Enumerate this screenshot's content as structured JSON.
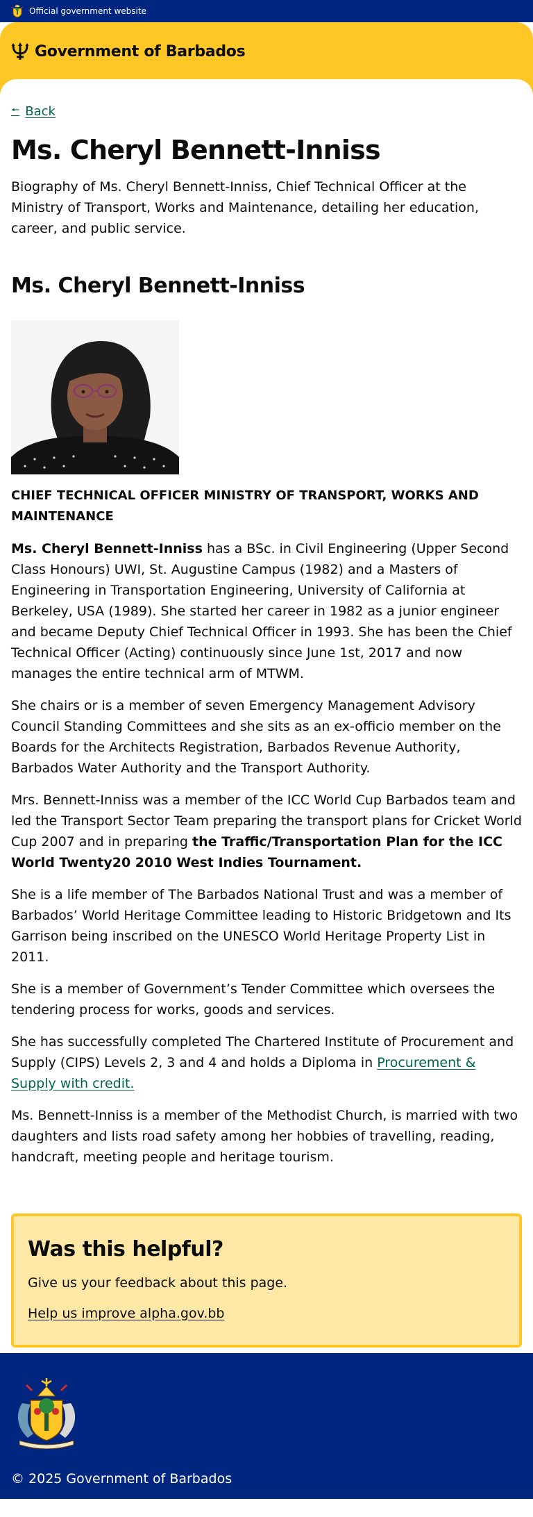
{
  "topbar": {
    "text": "Official government website"
  },
  "header": {
    "brand": "Government of Barbados"
  },
  "nav": {
    "back_label": "Back"
  },
  "page": {
    "title": "Ms. Cheryl Bennett-Inniss",
    "summary": "Biography of Ms. Cheryl Bennett-Inniss, Chief Technical Officer at the Ministry of Transport, Works and Maintenance, detailing her education, career, and public service."
  },
  "bio": {
    "heading": "Ms. Cheryl Bennett-Inniss",
    "role": "CHIEF TECHNICAL OFFICER MINISTRY OF TRANSPORT, WORKS AND MAINTENANCE",
    "p1_name": "Ms. Cheryl Bennett-Inniss",
    "p1_rest": " has a BSc. in Civil Engineering (Upper Second Class Honours) UWI, St. Augustine Campus (1982) and a Masters of Engineering in Transportation Engineering, University of California at Berkeley, USA (1989). She started her career in 1982 as a junior engineer and became Deputy Chief Technical Officer in 1993. She has been the Chief Technical Officer (Acting) continuously since June 1st, 2017 and now manages the entire technical arm of MTWM.",
    "p2": "She chairs or is a member of seven Emergency Management Advisory Council Standing Committees and she sits as an ex-officio member on the Boards for the Architects Registration, Barbados Revenue Authority, Barbados Water Authority and the Transport Authority.",
    "p3_start": "Mrs. Bennett-Inniss was a member of the ICC World Cup Barbados team and led the Transport Sector Team preparing the transport plans for Cricket World Cup 2007 and in preparing ",
    "p3_bold": "the Traffic/Transportation Plan for the ICC World Twenty20 2010 West Indies Tournament.",
    "p4": "She is a life member of The Barbados National Trust and was a member of Barbados’ World Heritage Committee leading to Historic Bridgetown and Its Garrison being inscribed on the UNESCO World Heritage Property List in 2011.",
    "p5": "She is a member of Government’s Tender Committee which oversees the tendering process for works, goods and services.",
    "p6_start": "She has successfully completed The Chartered Institute of Procurement and Supply (CIPS) Levels 2, 3 and 4 and holds a Diploma in ",
    "p6_link": "Procurement & Supply with credit.",
    "p7": "Ms. Bennett-Inniss is a member of the Methodist Church, is married with two daughters and lists road safety among her hobbies of travelling, reading, handcraft, meeting people and heritage tourism."
  },
  "feedback": {
    "title": "Was this helpful?",
    "text": "Give us your feedback about this page.",
    "link": "Help us improve alpha.gov.bb"
  },
  "footer": {
    "copyright": "© 2025 Government of Barbados"
  },
  "colors": {
    "navy": "#00267f",
    "gold": "#ffc726",
    "feedback_bg": "#ffe8a6",
    "link_green": "#00654a"
  }
}
